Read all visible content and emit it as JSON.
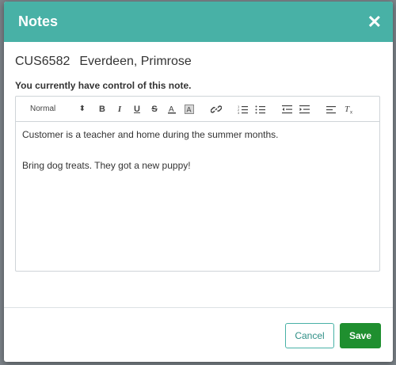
{
  "modal": {
    "title": "Notes",
    "close_glyph": "✕"
  },
  "customer": {
    "id": "CUS6582",
    "name": "Everdeen, Primrose"
  },
  "control_message": "You currently have control of this note.",
  "editor": {
    "format_select": "Normal",
    "paragraphs": [
      "Customer is a teacher and home during the summer months.",
      "Bring dog treats. They got a new puppy!"
    ]
  },
  "buttons": {
    "cancel": "Cancel",
    "save": "Save"
  },
  "colors": {
    "header": "#48b1a6",
    "save": "#1f8f2f",
    "cancel_border": "#48b1a6"
  }
}
